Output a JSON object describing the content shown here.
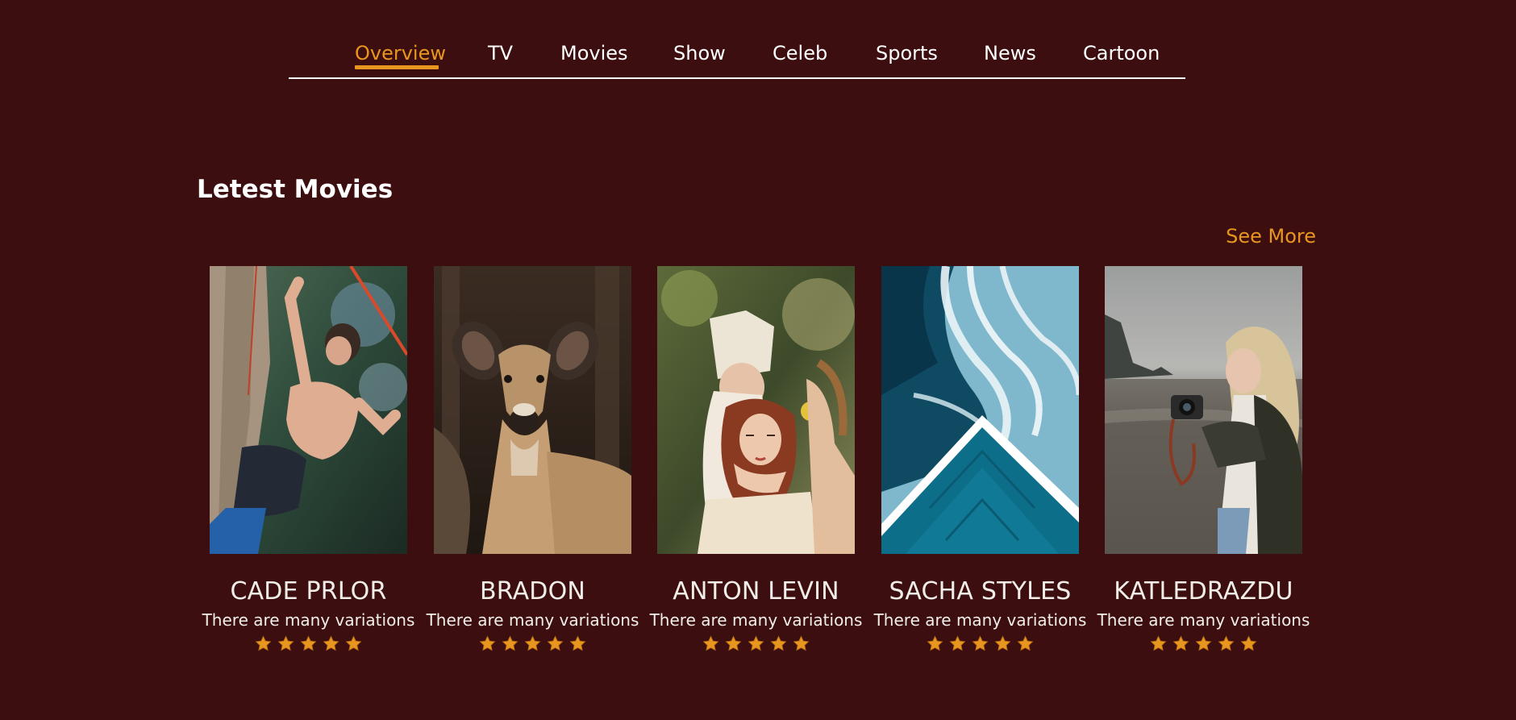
{
  "nav": {
    "items": [
      {
        "label": "Overview",
        "active": true
      },
      {
        "label": "TV",
        "active": false
      },
      {
        "label": "Movies",
        "active": false
      },
      {
        "label": "Show",
        "active": false
      },
      {
        "label": "Celeb",
        "active": false
      },
      {
        "label": "Sports",
        "active": false
      },
      {
        "label": "News",
        "active": false
      },
      {
        "label": "Cartoon",
        "active": false
      }
    ]
  },
  "section": {
    "title": "Letest Movies",
    "see_more": "See More"
  },
  "cards": [
    {
      "name": "CADE PRLOR",
      "description": "There are many variations",
      "rating": 5,
      "image": "rock-climber-photo"
    },
    {
      "name": "BRADON",
      "description": "There are many variations",
      "rating": 5,
      "image": "deer-photo"
    },
    {
      "name": "ANTON LEVIN",
      "description": "There are many variations",
      "rating": 5,
      "image": "two-women-photo"
    },
    {
      "name": "SACHA STYLES",
      "description": "There are many variations",
      "rating": 5,
      "image": "ocean-pool-aerial-photo"
    },
    {
      "name": "KATLEDRAZDU",
      "description": "There are many variations",
      "rating": 5,
      "image": "woman-with-camera-photo"
    }
  ],
  "colors": {
    "background": "#3c0e0f",
    "accent": "#e8961f",
    "text": "#ffffff"
  },
  "icons": {
    "rating": "star-icon"
  }
}
